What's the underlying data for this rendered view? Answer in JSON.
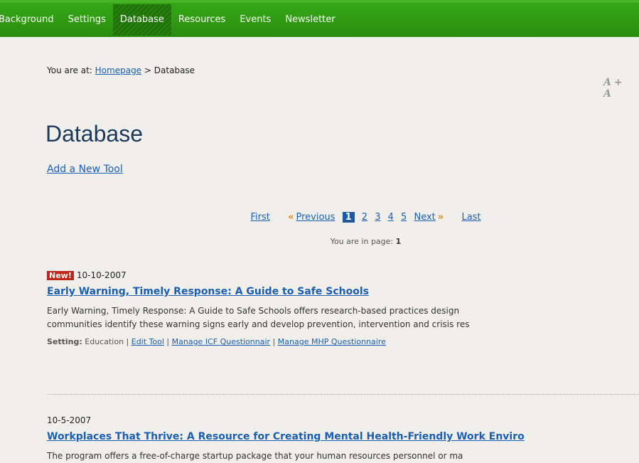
{
  "nav": {
    "items": [
      {
        "label": "Background",
        "active": false
      },
      {
        "label": "Settings",
        "active": false
      },
      {
        "label": "Database",
        "active": true
      },
      {
        "label": "Resources",
        "active": false
      },
      {
        "label": "Events",
        "active": false
      },
      {
        "label": "Newsletter",
        "active": false
      }
    ]
  },
  "breadcrumb": {
    "prefix": "You are at:",
    "home": "Homepage",
    "separator": ">",
    "current": "Database"
  },
  "font_tools": {
    "label": "A+ A"
  },
  "page_title": "Database",
  "add_tool_link": "Add a New Tool",
  "pager": {
    "first": "First",
    "previous": "Previous",
    "prev_arrow": "«",
    "pages": [
      "1",
      "2",
      "3",
      "4",
      "5"
    ],
    "current_page": "1",
    "next": "Next",
    "next_arrow": "»",
    "last": "Last",
    "info_prefix": "You are in page:",
    "info_value": "1"
  },
  "entries": [
    {
      "badge": "New!",
      "date": "10-10-2007",
      "title": "Early Warning, Timely Response: A Guide to Safe Schools",
      "desc_line1": "Early Warning, Timely Response: A Guide to Safe Schools offers research-based practices design",
      "desc_line2": "communities identify these warning signs early and develop prevention, intervention and crisis res",
      "setting_label": "Setting:",
      "setting_value": "Education",
      "edit_link": "Edit Tool",
      "icf_link": "Manage ICF Questionnair",
      "mhp_link": "Manage MHP Questionnaire"
    },
    {
      "badge": "",
      "date": "10-5-2007",
      "title": "Workplaces That Thrive: A Resource for Creating Mental Health-Friendly Work Enviro",
      "desc_line1": "The program offers a free-of-charge startup package that your human resources personnel or ma"
    }
  ]
}
